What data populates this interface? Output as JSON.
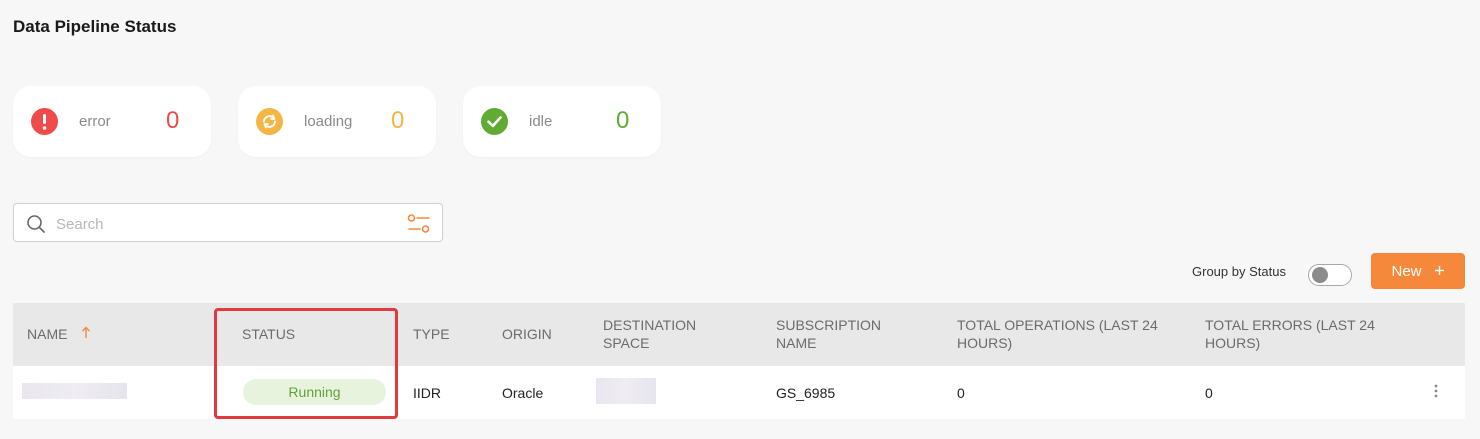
{
  "page": {
    "title": "Data Pipeline Status"
  },
  "stats": [
    {
      "label": "error",
      "count": "0",
      "color": "#ef4b4b",
      "icon": "exclamation-icon"
    },
    {
      "label": "loading",
      "count": "0",
      "color": "#f5b545",
      "icon": "refresh-icon"
    },
    {
      "label": "idle",
      "count": "0",
      "color": "#5fab34",
      "icon": "check-icon"
    }
  ],
  "search": {
    "placeholder": "Search",
    "value": ""
  },
  "toolbar": {
    "group_by_label": "Group by Status",
    "group_by_enabled": false,
    "new_label": "New",
    "new_icon": "plus-icon"
  },
  "table": {
    "columns": {
      "name": "NAME",
      "status": "STATUS",
      "type": "TYPE",
      "origin": "ORIGIN",
      "destination_l1": "DESTINATION",
      "destination_l2": "SPACE",
      "subscription_l1": "SUBSCRIPTION",
      "subscription_l2": "NAME",
      "total_ops_l1": "TOTAL OPERATIONS (LAST 24",
      "total_ops_l2": "HOURS)",
      "total_errors_l1": "TOTAL ERRORS (LAST 24",
      "total_errors_l2": "HOURS)"
    },
    "sort": {
      "column": "NAME",
      "direction": "ascending"
    },
    "rows": [
      {
        "status": "Running",
        "type": "IIDR",
        "origin": "Oracle",
        "subscription": "GS_6985",
        "total_operations": "0",
        "total_errors": "0"
      }
    ]
  },
  "colors": {
    "accent": "#f5883a",
    "highlight": "#e0393e",
    "running_text": "#5fa33a",
    "running_bg": "#e8f3dd"
  }
}
